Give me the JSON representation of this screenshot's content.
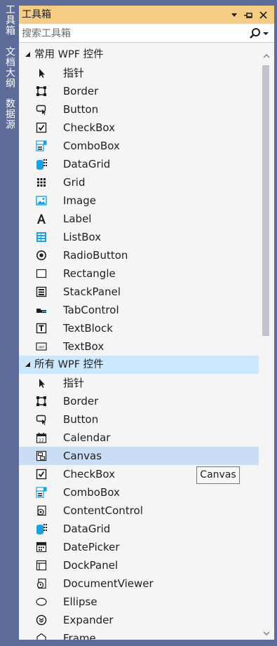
{
  "side_tabs": [
    "工具箱",
    "文档大纲",
    "数据源"
  ],
  "title": "工具箱",
  "search": {
    "placeholder": "搜索工具箱"
  },
  "tooltip": "Canvas",
  "groups": [
    {
      "label": "常用 WPF 控件",
      "items": [
        {
          "label": "指针",
          "icon": "pointer-icon"
        },
        {
          "label": "Border",
          "icon": "border-icon"
        },
        {
          "label": "Button",
          "icon": "button-icon"
        },
        {
          "label": "CheckBox",
          "icon": "checkbox-icon"
        },
        {
          "label": "ComboBox",
          "icon": "combobox-icon"
        },
        {
          "label": "DataGrid",
          "icon": "datagrid-icon"
        },
        {
          "label": "Grid",
          "icon": "grid-icon"
        },
        {
          "label": "Image",
          "icon": "image-icon"
        },
        {
          "label": "Label",
          "icon": "label-icon"
        },
        {
          "label": "ListBox",
          "icon": "listbox-icon"
        },
        {
          "label": "RadioButton",
          "icon": "radiobutton-icon"
        },
        {
          "label": "Rectangle",
          "icon": "rectangle-icon"
        },
        {
          "label": "StackPanel",
          "icon": "stackpanel-icon"
        },
        {
          "label": "TabControl",
          "icon": "tabcontrol-icon"
        },
        {
          "label": "TextBlock",
          "icon": "textblock-icon"
        },
        {
          "label": "TextBox",
          "icon": "textbox-icon"
        }
      ]
    },
    {
      "label": "所有 WPF 控件",
      "items": [
        {
          "label": "指针",
          "icon": "pointer-icon"
        },
        {
          "label": "Border",
          "icon": "border-icon"
        },
        {
          "label": "Button",
          "icon": "button-icon"
        },
        {
          "label": "Calendar",
          "icon": "calendar-icon"
        },
        {
          "label": "Canvas",
          "icon": "canvas-icon",
          "selected": true
        },
        {
          "label": "CheckBox",
          "icon": "checkbox-icon"
        },
        {
          "label": "ComboBox",
          "icon": "combobox-icon"
        },
        {
          "label": "ContentControl",
          "icon": "contentcontrol-icon"
        },
        {
          "label": "DataGrid",
          "icon": "datagrid-icon"
        },
        {
          "label": "DatePicker",
          "icon": "datepicker-icon"
        },
        {
          "label": "DockPanel",
          "icon": "dockpanel-icon"
        },
        {
          "label": "DocumentViewer",
          "icon": "documentviewer-icon"
        },
        {
          "label": "Ellipse",
          "icon": "ellipse-icon"
        },
        {
          "label": "Expander",
          "icon": "expander-icon"
        },
        {
          "label": "Frame",
          "icon": "frame-icon"
        }
      ]
    }
  ]
}
